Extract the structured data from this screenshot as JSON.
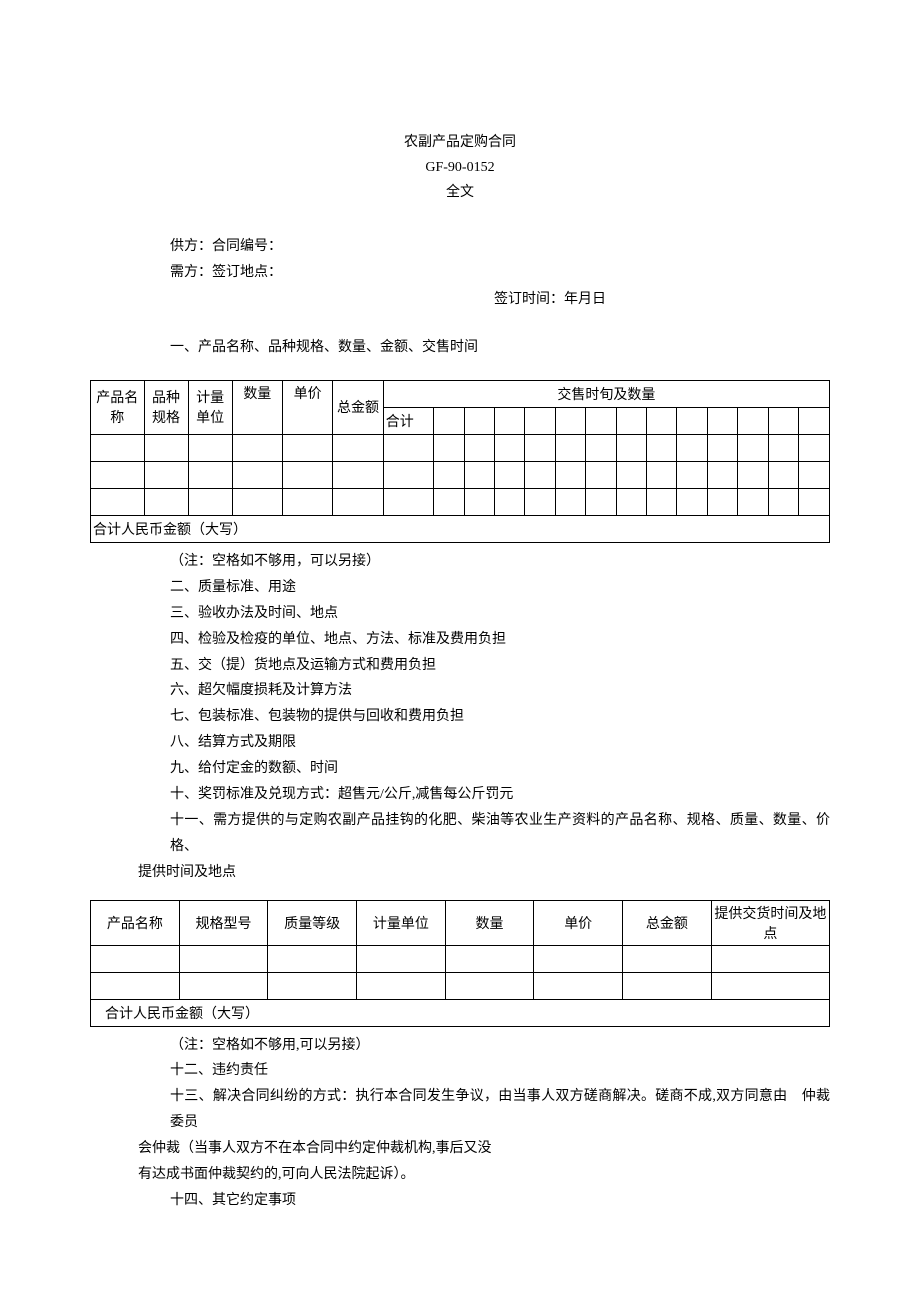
{
  "title": {
    "line1": "农副产品定购合同",
    "line2": "GF-90-0152",
    "line3": "全文"
  },
  "meta": {
    "supplier": "供方：合同编号：",
    "demander": "需方：签订地点：",
    "sign_time": "签订时间：年月日"
  },
  "section1_heading": "一、产品名称、品种规格、数量、金额、交售时间",
  "table1": {
    "col_product": "产品名称",
    "col_spec": "品种规格",
    "col_unit": "计量单位",
    "col_qty": "数量",
    "col_price": "单价",
    "col_total": "总金额",
    "col_delivery": "交售时旬及数量",
    "col_subtotal": "合计",
    "footer": "合计人民币金额（大写）"
  },
  "sections": {
    "note1": "（注：空格如不够用，可以另接）",
    "s2": "二、质量标准、用途",
    "s3": "三、验收办法及时间、地点",
    "s4": "四、检验及检疫的单位、地点、方法、标准及费用负担",
    "s5": "五、交（提）货地点及运输方式和费用负担",
    "s6": "六、超欠幅度损耗及计算方法",
    "s7": "七、包装标准、包装物的提供与回收和费用负担",
    "s8": "八、结算方式及期限",
    "s9": "九、给付定金的数额、时间",
    "s10": "十、奖罚标准及兑现方式：超售元/公斤,减售每公斤罚元",
    "s11a": "十一、需方提供的与定购农副产品挂钩的化肥、柴油等农业生产资料的产品名称、规格、质量、数量、价格、",
    "s11b": "提供时间及地点"
  },
  "table2": {
    "col_product": "产品名称",
    "col_spec": "规格型号",
    "col_quality": "质量等级",
    "col_unit": "计量单位",
    "col_qty": "数量",
    "col_price": "单价",
    "col_total": "总金额",
    "col_delivery": "提供交货时间及地点",
    "footer": "合计人民币金额（大写）"
  },
  "tail": {
    "note2": "（注：空格如不够用,可以另接）",
    "s12": "十二、违约责任",
    "s13a": "十三、解决合同纠纷的方式：执行本合同发生争议，由当事人双方磋商解决。磋商不成,双方同意由　仲裁委员",
    "s13b": "会仲裁（当事人双方不在本合同中约定仲裁机构,事后又没",
    "s13c": "有达成书面仲裁契约的,可向人民法院起诉）。",
    "s14": "十四、其它约定事项"
  }
}
